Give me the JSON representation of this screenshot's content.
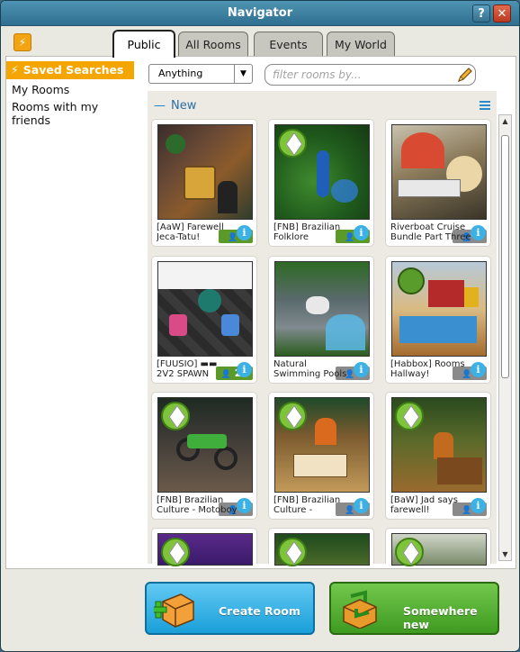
{
  "window": {
    "title": "Navigator",
    "help_label": "?",
    "close_label": "✕"
  },
  "tabs": [
    {
      "label": "Public",
      "active": true
    },
    {
      "label": "All Rooms",
      "active": false
    },
    {
      "label": "Events",
      "active": false
    },
    {
      "label": "My World",
      "active": false
    }
  ],
  "sidebar": {
    "header": "Saved Searches",
    "items": [
      "My Rooms",
      "Rooms with my friends"
    ]
  },
  "filter": {
    "selected": "Anything",
    "search_placeholder": "filter rooms by..."
  },
  "section": {
    "title": "New"
  },
  "rooms": [
    {
      "name": "[AaW] Farewell Jeca-Tatu!",
      "users": "2",
      "active": true
    },
    {
      "name": "[FNB] Brazilian Folklore",
      "users": "5",
      "active": true
    },
    {
      "name": "Riverboat Cruise Bundle Part Three",
      "users": "0",
      "active": false
    },
    {
      "name": "[FUUSIO] ▬▬ 2V2 SPAWN",
      "users": "21",
      "active": true
    },
    {
      "name": "Natural Swimming Pools",
      "users": "0",
      "active": false
    },
    {
      "name": "[Habbox] Rooms Hallway!",
      "users": "0",
      "active": false
    },
    {
      "name": "[FNB] Brazilian Culture - Motoboy",
      "users": "0",
      "active": false
    },
    {
      "name": "[FNB] Brazilian Culture -",
      "users": "0",
      "active": false
    },
    {
      "name": "[BaW] Jad says farewell!",
      "users": "0",
      "active": false
    }
  ],
  "buttons": {
    "create_room": "Create Room",
    "somewhere_new": "Somewhere new"
  },
  "colors": {
    "accent_orange": "#f5a500",
    "active_users": "#5b9a29",
    "info_blue": "#3cb1e6"
  }
}
